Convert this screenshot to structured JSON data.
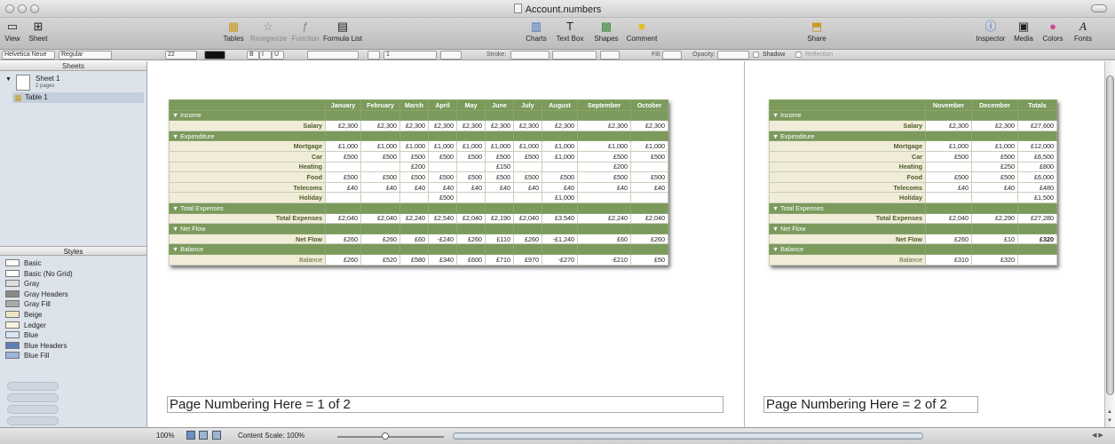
{
  "window": {
    "title": "Account.numbers"
  },
  "toolbar": {
    "left": [
      {
        "label": "View",
        "icon": "view-icon"
      },
      {
        "label": "Sheet",
        "icon": "sheet-icon"
      }
    ],
    "center": [
      {
        "label": "Tables",
        "icon": "tables-icon"
      },
      {
        "label": "Reorganize",
        "icon": "reorganize-icon"
      },
      {
        "label": "Function",
        "icon": "function-icon"
      },
      {
        "label": "Formula List",
        "icon": "formula-list-icon"
      },
      {
        "label": "Charts",
        "icon": "charts-icon"
      },
      {
        "label": "Text Box",
        "icon": "text-box-icon"
      },
      {
        "label": "Shapes",
        "icon": "shapes-icon"
      },
      {
        "label": "Comment",
        "icon": "comment-icon"
      },
      {
        "label": "Share",
        "icon": "share-icon"
      }
    ],
    "right": [
      {
        "label": "Inspector",
        "icon": "inspector-icon"
      },
      {
        "label": "Media",
        "icon": "media-icon"
      },
      {
        "label": "Colors",
        "icon": "colors-icon"
      },
      {
        "label": "Fonts",
        "icon": "fonts-icon"
      }
    ]
  },
  "format_bar": {
    "font": "Helvetica Neue",
    "style": "Regular",
    "size": "22",
    "bold": "B",
    "italic": "I",
    "underline": "U",
    "line_spacing": "1",
    "stroke_label": "Stroke:",
    "fill_label": "Fill:",
    "opacity_label": "Opacity:",
    "shadow_label": "Shadow",
    "reflection_label": "Reflection"
  },
  "sidebar": {
    "sheets_header": "Sheets",
    "sheet": {
      "name": "Sheet 1",
      "subtitle": "2 pages"
    },
    "table": {
      "name": "Table 1"
    },
    "styles_header": "Styles",
    "styles": [
      "Basic",
      "Basic (No Grid)",
      "Gray",
      "Gray Headers",
      "Gray Fill",
      "Beige",
      "Ledger",
      "Blue",
      "Blue Headers",
      "Blue Fill"
    ]
  },
  "page1": {
    "months": [
      "January",
      "February",
      "March",
      "April",
      "May",
      "June",
      "July",
      "August",
      "September",
      "October"
    ],
    "groups": [
      {
        "name": "▼ Income",
        "rows": [
          {
            "label": "Salary",
            "values": [
              "£2,300",
              "£2,300",
              "£2,300",
              "£2,300",
              "£2,300",
              "£2,300",
              "£2,300",
              "£2,300",
              "£2,300",
              "£2,300"
            ]
          }
        ]
      },
      {
        "name": "▼ Expenditure",
        "rows": [
          {
            "label": "Mortgage",
            "values": [
              "£1,000",
              "£1,000",
              "£1,000",
              "£1,000",
              "£1,000",
              "£1,000",
              "£1,000",
              "£1,000",
              "£1,000",
              "£1,000"
            ]
          },
          {
            "label": "Car",
            "values": [
              "£500",
              "£500",
              "£500",
              "£500",
              "£500",
              "£500",
              "£500",
              "£1,000",
              "£500",
              "£500"
            ]
          },
          {
            "label": "Heating",
            "values": [
              "",
              "",
              "£200",
              "",
              "",
              "£150",
              "",
              "",
              "£200",
              ""
            ]
          },
          {
            "label": "Food",
            "values": [
              "£500",
              "£500",
              "£500",
              "£500",
              "£500",
              "£500",
              "£500",
              "£500",
              "£500",
              "£500"
            ]
          },
          {
            "label": "Telecoms",
            "values": [
              "£40",
              "£40",
              "£40",
              "£40",
              "£40",
              "£40",
              "£40",
              "£40",
              "£40",
              "£40"
            ]
          },
          {
            "label": "Holiday",
            "values": [
              "",
              "",
              "",
              "£500",
              "",
              "",
              "",
              "£1,000",
              "",
              ""
            ]
          }
        ]
      },
      {
        "name": "▼ Total Expenses",
        "rows": [
          {
            "label": "Total Expenses",
            "values": [
              "£2,040",
              "£2,040",
              "£2,240",
              "£2,540",
              "£2,040",
              "£2,190",
              "£2,040",
              "£3,540",
              "£2,240",
              "£2,040"
            ]
          }
        ]
      },
      {
        "name": "▼ Net Flow",
        "rows": [
          {
            "label": "Net Flow",
            "values": [
              "£260",
              "£260",
              "£60",
              "-£240",
              "£260",
              "£110",
              "£260",
              "-£1,240",
              "£60",
              "£260"
            ]
          }
        ]
      },
      {
        "name": "▼ Balance",
        "rows": [
          {
            "label": "Balance",
            "values": [
              "£260",
              "£520",
              "£580",
              "£340",
              "£600",
              "£710",
              "£970",
              "-£270",
              "-£210",
              "£50"
            ]
          }
        ]
      }
    ],
    "footer": "Page Numbering Here = 1 of 2"
  },
  "page2": {
    "months": [
      "November",
      "December",
      "Totals"
    ],
    "groups": [
      {
        "name": "▼ Income",
        "rows": [
          {
            "label": "Salary",
            "values": [
              "£2,300",
              "£2,300",
              "£27,600"
            ]
          }
        ]
      },
      {
        "name": "▼ Expenditure",
        "rows": [
          {
            "label": "Mortgage",
            "values": [
              "£1,000",
              "£1,000",
              "£12,000"
            ]
          },
          {
            "label": "Car",
            "values": [
              "£500",
              "£500",
              "£6,500"
            ]
          },
          {
            "label": "Heating",
            "values": [
              "",
              "£250",
              "£800"
            ]
          },
          {
            "label": "Food",
            "values": [
              "£500",
              "£500",
              "£6,000"
            ]
          },
          {
            "label": "Telecoms",
            "values": [
              "£40",
              "£40",
              "£480"
            ]
          },
          {
            "label": "Holiday",
            "values": [
              "",
              "",
              "£1,500"
            ]
          }
        ]
      },
      {
        "name": "▼ Total Expenses",
        "rows": [
          {
            "label": "Total Expenses",
            "values": [
              "£2,040",
              "£2,290",
              "£27,280"
            ]
          }
        ]
      },
      {
        "name": "▼ Net Flow",
        "rows": [
          {
            "label": "Net Flow",
            "values": [
              "£260",
              "£10",
              "£320"
            ]
          }
        ]
      },
      {
        "name": "▼ Balance",
        "rows": [
          {
            "label": "Balance",
            "values": [
              "£310",
              "£320",
              ""
            ]
          }
        ]
      }
    ],
    "footer": "Page Numbering Here = 2 of 2"
  },
  "statusbar": {
    "zoom": "100%",
    "content_scale": "Content Scale: 100%"
  },
  "colors": {
    "table_header": "#7b9a5c",
    "label_bg": "#f1ecd7",
    "label_text": "#4c5e2c"
  }
}
